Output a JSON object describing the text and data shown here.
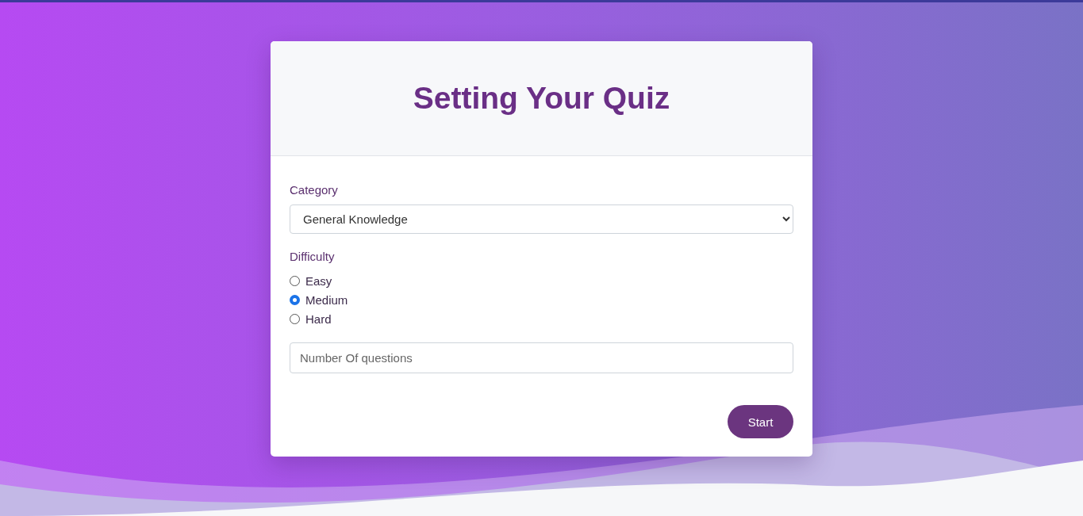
{
  "header": {
    "title": "Setting Your Quiz"
  },
  "form": {
    "category": {
      "label": "Category",
      "value": "General Knowledge"
    },
    "difficulty": {
      "label": "Difficulty",
      "options": [
        {
          "label": "Easy",
          "selected": false
        },
        {
          "label": "Medium",
          "selected": true
        },
        {
          "label": "Hard",
          "selected": false
        }
      ]
    },
    "questions": {
      "placeholder": "Number Of questions"
    },
    "submit": {
      "label": "Start"
    }
  }
}
